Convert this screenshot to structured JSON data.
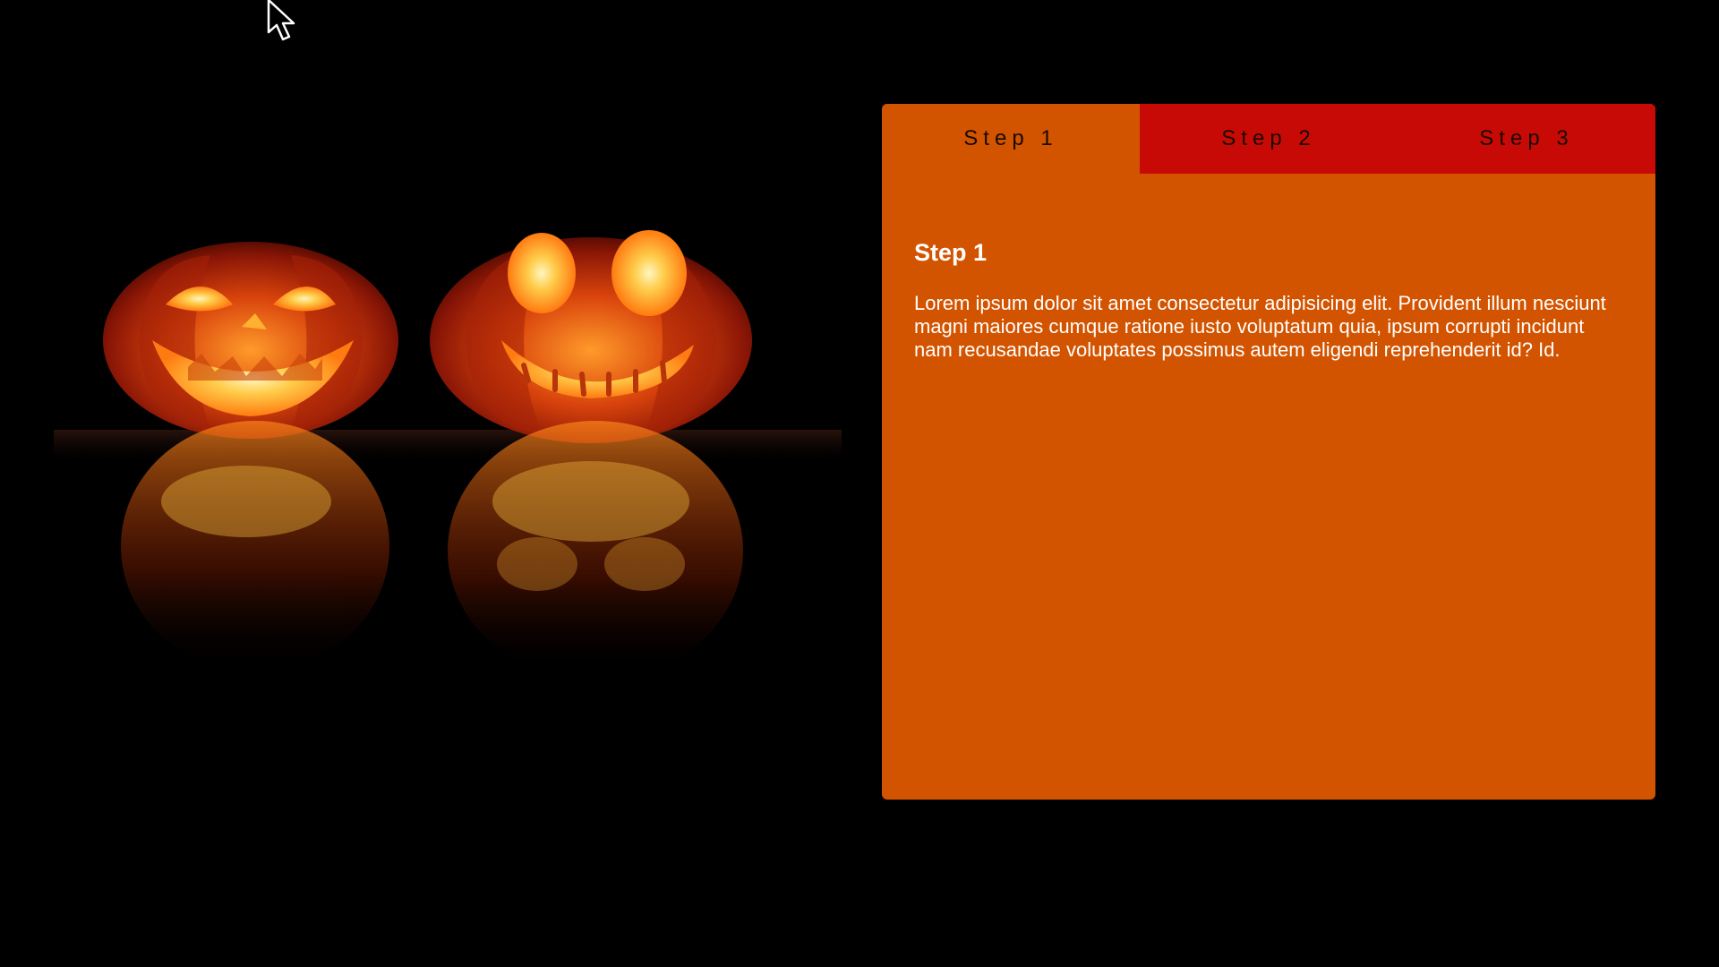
{
  "tabs": [
    {
      "label": "Step 1",
      "active": true
    },
    {
      "label": "Step 2",
      "active": false
    },
    {
      "label": "Step 3",
      "active": false
    }
  ],
  "panel": {
    "title": "Step 1",
    "body": "Lorem ipsum dolor sit amet consectetur adipisicing elit. Provident illum nesciunt magni maiores cumque ratione iusto voluptatum quia, ipsum corrupti incidunt nam recusandae voluptates possimus autem eligendi reprehenderit id? Id."
  },
  "colors": {
    "background": "#000000",
    "active_tab": "#d35400",
    "tab_bar": "#c80a06",
    "panel_text": "#ffffff",
    "tab_text": "#1a0a00"
  },
  "image": {
    "subject": "two carved glowing jack-o'-lantern pumpkins reflected on a dark surface"
  },
  "icons": {
    "cursor": "mouse-pointer-icon"
  }
}
